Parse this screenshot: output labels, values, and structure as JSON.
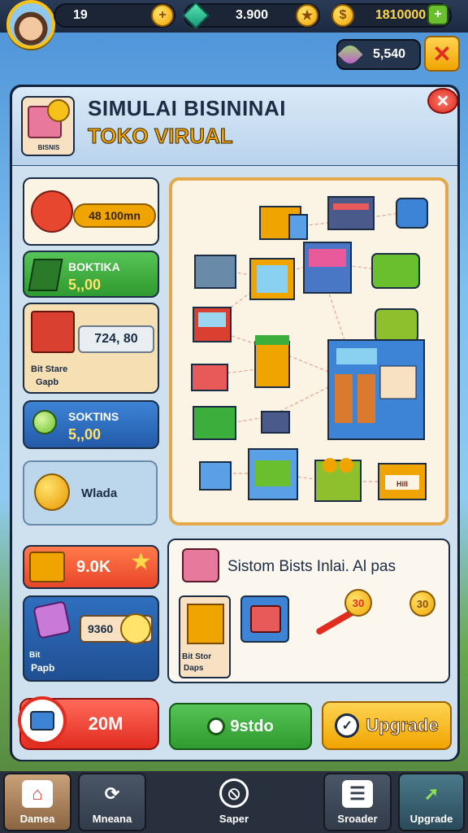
{
  "topbar": {
    "level": "19",
    "gems": "3.900",
    "coins": "1810000",
    "secondary_currency": "5,540"
  },
  "panel": {
    "title_line1": "SIMULAI BISININAI",
    "title_line2": "TOKO VIRUAL",
    "icon_caption": "BISNIS"
  },
  "left": {
    "card1_value": "48 100mn",
    "card2_label": "BOKTIKA",
    "card2_value": "5,,00",
    "card3_value": "724, 80",
    "card3_caption1": "Bit Stare",
    "card3_caption2": "Gapb",
    "card4_label": "SOKTINS",
    "card4_value": "5,,00",
    "card5_label": "Wlada",
    "card6_value": "9.0K",
    "card7_value": "9360",
    "card7_caption1": "Bit",
    "card7_caption2": "Papb"
  },
  "map": {
    "badge_label": "Hill"
  },
  "system": {
    "title": "Sistom Bists Inlai. Al pas",
    "item1_caption1": "Bit Stor",
    "item1_caption2": "Daps",
    "token1": "30",
    "token2": "30"
  },
  "actions": {
    "red_label": "20M",
    "green_label": "9stdo",
    "yellow_label": "Upgrade"
  },
  "nav": {
    "n1": "Damea",
    "n2": "Mneana",
    "n3": "Saper",
    "n4": "Sroader",
    "n5": "Upgrade"
  },
  "colors": {
    "accent": "#f0a400",
    "green": "#3cae3c",
    "red": "#e12c20",
    "blue": "#2f6fbe"
  }
}
